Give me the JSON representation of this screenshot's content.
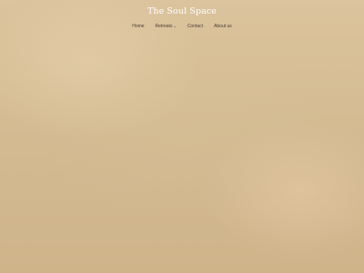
{
  "site": {
    "title": "The Soul Space"
  },
  "nav": {
    "items": [
      {
        "label": "Home"
      },
      {
        "label": "Retreats",
        "icon": "chevron-down-icon"
      },
      {
        "label": "Contact"
      },
      {
        "label": "About us"
      }
    ]
  },
  "colors": {
    "background": "#d2b98f",
    "title_text": "#ffffff",
    "nav_text": "#4a3f33"
  }
}
